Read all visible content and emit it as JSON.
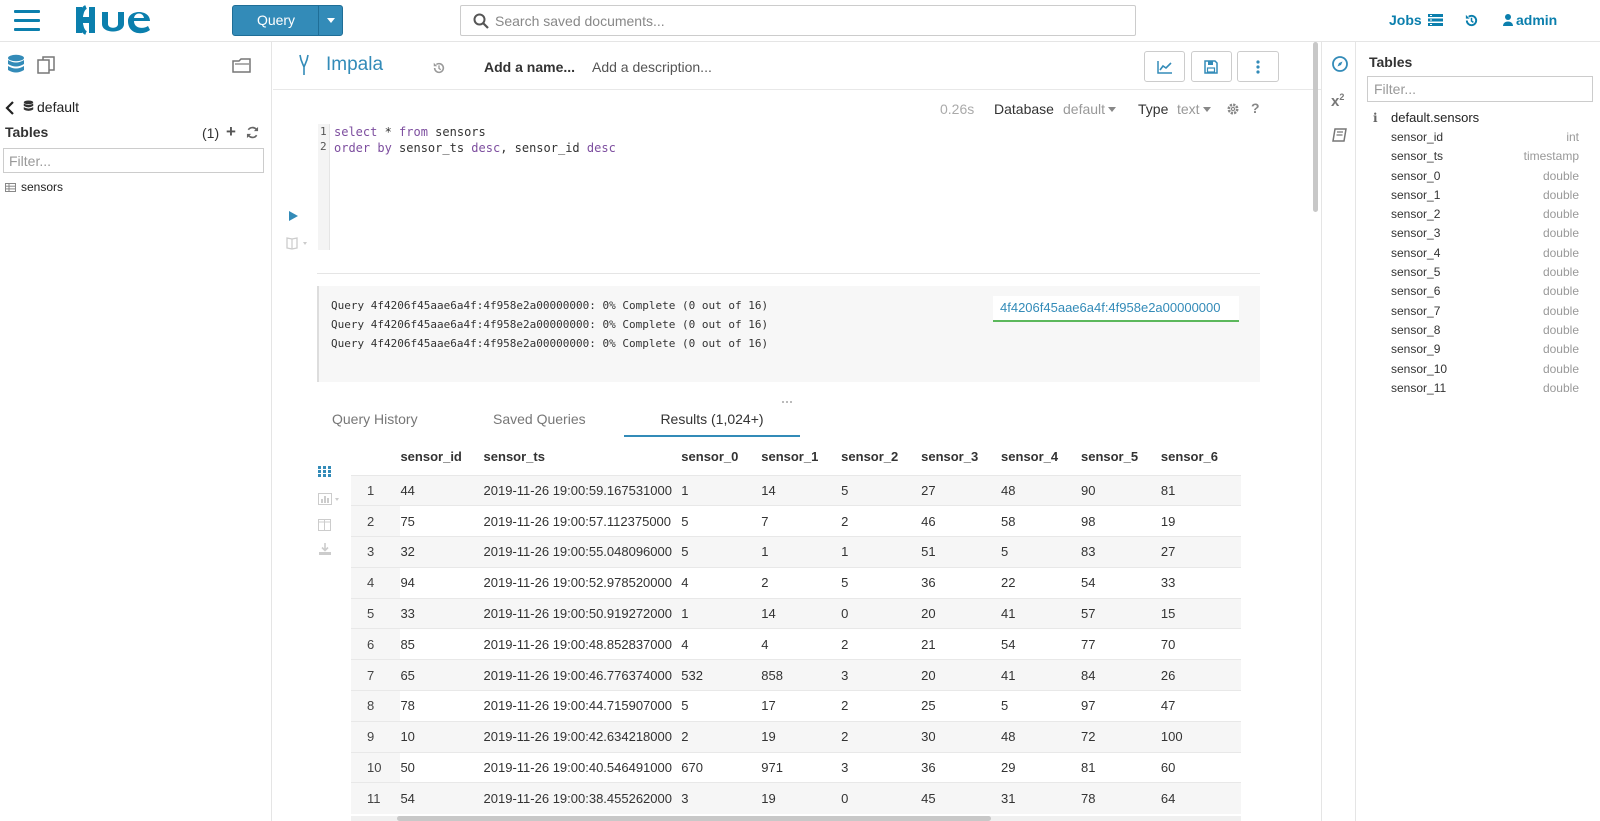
{
  "nav": {
    "search_placeholder": "Search saved documents...",
    "query_button": "Query",
    "jobs": "Jobs",
    "user": "admin"
  },
  "left": {
    "database": "default",
    "tables_title": "Tables",
    "table_count": "(1)",
    "filter_placeholder": "Filter...",
    "tables": [
      "sensors"
    ]
  },
  "editor": {
    "engine": "Impala",
    "name_placeholder": "Add a name...",
    "description_placeholder": "Add a description...",
    "exec_time": "0.26s",
    "database_label": "Database",
    "database_value": "default",
    "type_label": "Type",
    "type_value": "text",
    "help": "?",
    "line_numbers": [
      "1",
      "2"
    ],
    "code": {
      "l1_kw1": "select",
      "l1_mid": " * ",
      "l1_kw2": "from",
      "l1_rest": " sensors",
      "l2_kw1": "order by",
      "l2_mid": " sensor_ts ",
      "l2_kw2": "desc",
      "l2_mid2": ", sensor_id ",
      "l2_kw3": "desc"
    }
  },
  "log": {
    "lines": [
      "Query 4f4206f45aae6a4f:4f958e2a00000000: 0% Complete (0 out of 16)",
      "Query 4f4206f45aae6a4f:4f958e2a00000000: 0% Complete (0 out of 16)",
      "Query 4f4206f45aae6a4f:4f958e2a00000000: 0% Complete (0 out of 16)"
    ],
    "query_id": "4f4206f45aae6a4f:4f958e2a00000000"
  },
  "tabs": {
    "history": "Query History",
    "saved": "Saved Queries",
    "results": "Results (1,024+)"
  },
  "results": {
    "columns": [
      "sensor_id",
      "sensor_ts",
      "sensor_0",
      "sensor_1",
      "sensor_2",
      "sensor_3",
      "sensor_4",
      "sensor_5",
      "sensor_6"
    ],
    "rows": [
      [
        "1",
        "44",
        "2019-11-26 19:00:59.167531000",
        "1",
        "14",
        "5",
        "27",
        "48",
        "90",
        "81"
      ],
      [
        "2",
        "75",
        "2019-11-26 19:00:57.112375000",
        "5",
        "7",
        "2",
        "46",
        "58",
        "98",
        "19"
      ],
      [
        "3",
        "32",
        "2019-11-26 19:00:55.048096000",
        "5",
        "1",
        "1",
        "51",
        "5",
        "83",
        "27"
      ],
      [
        "4",
        "94",
        "2019-11-26 19:00:52.978520000",
        "4",
        "2",
        "5",
        "36",
        "22",
        "54",
        "33"
      ],
      [
        "5",
        "33",
        "2019-11-26 19:00:50.919272000",
        "1",
        "14",
        "0",
        "20",
        "41",
        "57",
        "15"
      ],
      [
        "6",
        "85",
        "2019-11-26 19:00:48.852837000",
        "4",
        "4",
        "2",
        "21",
        "54",
        "77",
        "70"
      ],
      [
        "7",
        "65",
        "2019-11-26 19:00:46.776374000",
        "532",
        "858",
        "3",
        "20",
        "41",
        "84",
        "26"
      ],
      [
        "8",
        "78",
        "2019-11-26 19:00:44.715907000",
        "5",
        "17",
        "2",
        "25",
        "5",
        "97",
        "47"
      ],
      [
        "9",
        "10",
        "2019-11-26 19:00:42.634218000",
        "2",
        "19",
        "2",
        "30",
        "48",
        "72",
        "100"
      ],
      [
        "10",
        "50",
        "2019-11-26 19:00:40.546491000",
        "670",
        "971",
        "3",
        "36",
        "29",
        "81",
        "60"
      ],
      [
        "11",
        "54",
        "2019-11-26 19:00:38.455262000",
        "3",
        "19",
        "0",
        "45",
        "31",
        "78",
        "64"
      ]
    ]
  },
  "right": {
    "title": "Tables",
    "filter_placeholder": "Filter...",
    "table": "default.sensors",
    "info_glyph": "i",
    "columns": [
      {
        "name": "sensor_id",
        "type": "int"
      },
      {
        "name": "sensor_ts",
        "type": "timestamp"
      },
      {
        "name": "sensor_0",
        "type": "double"
      },
      {
        "name": "sensor_1",
        "type": "double"
      },
      {
        "name": "sensor_2",
        "type": "double"
      },
      {
        "name": "sensor_3",
        "type": "double"
      },
      {
        "name": "sensor_4",
        "type": "double"
      },
      {
        "name": "sensor_5",
        "type": "double"
      },
      {
        "name": "sensor_6",
        "type": "double"
      },
      {
        "name": "sensor_7",
        "type": "double"
      },
      {
        "name": "sensor_8",
        "type": "double"
      },
      {
        "name": "sensor_9",
        "type": "double"
      },
      {
        "name": "sensor_10",
        "type": "double"
      },
      {
        "name": "sensor_11",
        "type": "double"
      }
    ]
  },
  "colors": {
    "brand": "#0b7fad",
    "primary_button": "#338bb8",
    "success": "#5cb85c"
  },
  "icons": {
    "menu": "hamburger-icon",
    "search": "search-icon",
    "jobs": "jobs-list-icon",
    "history": "history-icon",
    "user": "user-icon",
    "database": "database-icon",
    "documents": "documents-icon",
    "files": "folder-icon",
    "chart": "line-chart-icon",
    "save": "floppy-disk-icon",
    "more": "vertical-ellipsis-icon",
    "run": "play-icon",
    "settings": "gear-icon",
    "assistant": "compass-icon",
    "functions": "function-icon",
    "docs": "book-icon"
  }
}
